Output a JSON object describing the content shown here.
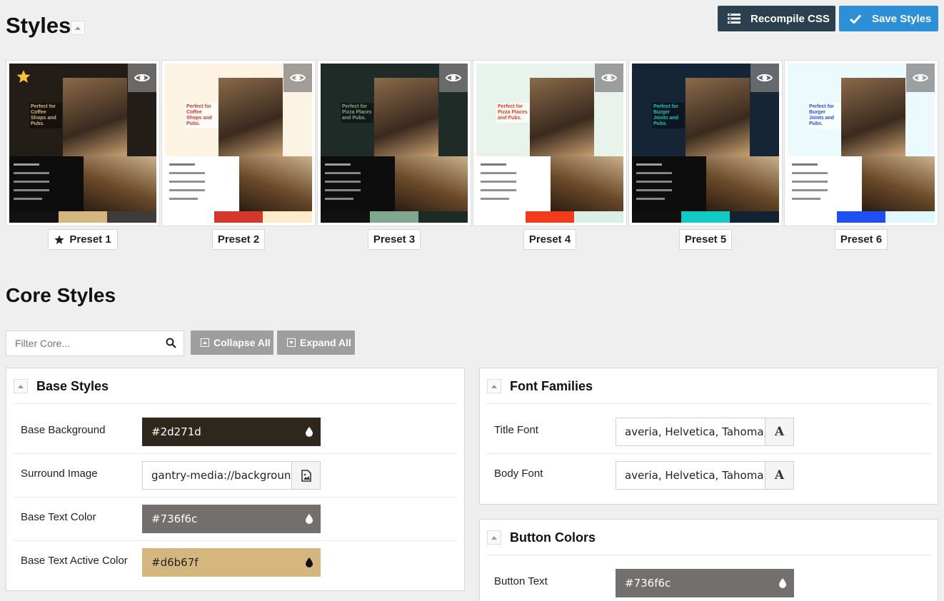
{
  "page": {
    "title": "Styles"
  },
  "toolbar": {
    "recompile_label": "Recompile CSS",
    "save_label": "Save Styles"
  },
  "presets": [
    {
      "label": "Preset 1",
      "active": true,
      "promo": "Perfect for Coffee Shops and Pubs.",
      "colors": [
        "#121212",
        "#d6b67f",
        "#3f3b39"
      ],
      "bg": "#231d18",
      "accent": "#d6b67f"
    },
    {
      "label": "Preset 2",
      "active": false,
      "promo": "Perfect for Coffee Shops and Pubs.",
      "colors": [
        "#ffffff",
        "#d4382c",
        "#fdebcb"
      ],
      "bg": "#fdf3e3",
      "accent": "#d4382c"
    },
    {
      "label": "Preset 3",
      "active": false,
      "promo": "Perfect for Pizza Places and Pubs.",
      "colors": [
        "#111111",
        "#7fa88f",
        "#1c2b24"
      ],
      "bg": "#1f2b26",
      "accent": "#7fa88f"
    },
    {
      "label": "Preset 4",
      "active": false,
      "promo": "Perfect for Pizza Places and Pubs.",
      "colors": [
        "#ffffff",
        "#f23a1c",
        "#dcefe4"
      ],
      "bg": "#e8f3ec",
      "accent": "#f23a1c"
    },
    {
      "label": "Preset 5",
      "active": false,
      "promo": "Perfect for Burger Joints and Pubs.",
      "colors": [
        "#101010",
        "#12c9c3",
        "#132233"
      ],
      "bg": "#152536",
      "accent": "#12c9c3"
    },
    {
      "label": "Preset 6",
      "active": false,
      "promo": "Perfect for Burger Joints and Pubs.",
      "colors": [
        "#ffffff",
        "#1f4ff0",
        "#dff8fd"
      ],
      "bg": "#eafafd",
      "accent": "#1f4ff0"
    }
  ],
  "core": {
    "title": "Core Styles",
    "filter_placeholder": "Filter Core...",
    "collapse_all": "Collapse All",
    "expand_all": "Expand All"
  },
  "base_styles": {
    "title": "Base Styles",
    "base_background_label": "Base Background",
    "base_background_value": "#2d271d",
    "surround_image_label": "Surround Image",
    "surround_image_value": "gantry-media://backgroun",
    "base_text_color_label": "Base Text Color",
    "base_text_color_value": "#736f6c",
    "base_text_active_label": "Base Text Active Color",
    "base_text_active_value": "#d6b67f"
  },
  "font_families": {
    "title": "Font Families",
    "title_font_label": "Title Font",
    "title_font_value": "averia, Helvetica, Tahoma,",
    "body_font_label": "Body Font",
    "body_font_value": "averia, Helvetica, Tahoma,"
  },
  "button_colors": {
    "title": "Button Colors",
    "button_text_label": "Button Text",
    "button_text_value": "#736f6c"
  }
}
